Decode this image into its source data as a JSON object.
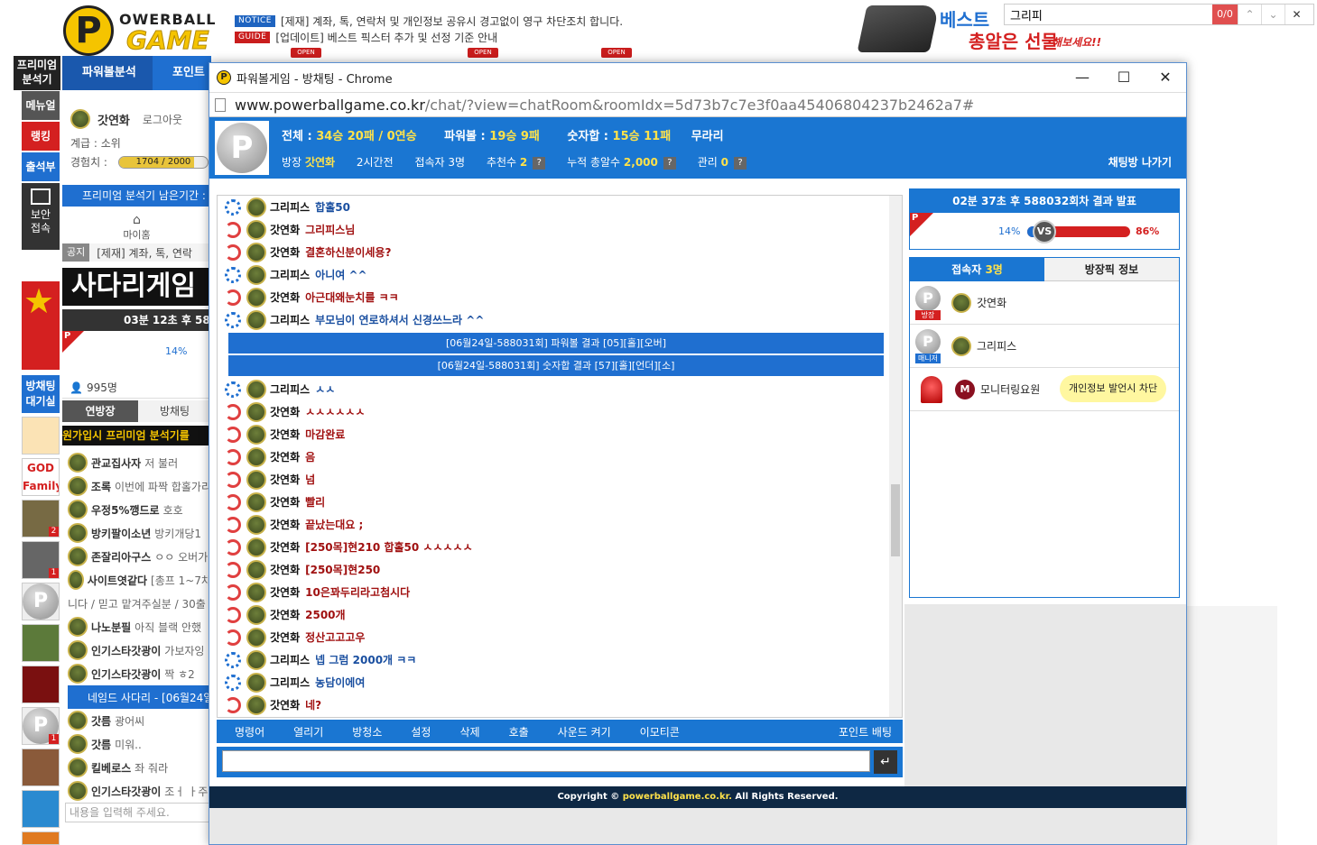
{
  "logo": {
    "letter": "P",
    "line1": "OWERBALL",
    "line2": "GAME"
  },
  "notices": [
    {
      "tag": "NOTICE",
      "text": "[제재] 계좌, 톡, 연락처 및 개인정보 공유시 경고없이 영구 차단조치 합니다."
    },
    {
      "tag": "GUIDE",
      "text": "[업데이트] 베스트 픽스터 추가 및 선정 기준 안내"
    }
  ],
  "open_tags": [
    "OPEN",
    "OPEN",
    "OPEN"
  ],
  "ad": {
    "line1": "베스트",
    "line2": "총알은 선물",
    "line3": "해보세요!!"
  },
  "find_bar": {
    "query": "그리피",
    "count": "0/0",
    "prev": "⌃",
    "next": "⌄",
    "close": "✕"
  },
  "left_nav": {
    "premium": "프리미엄\n분석기",
    "manual": "메뉴얼",
    "ranking": "랭킹",
    "attendance": "출석부",
    "secure": "보안\n접속",
    "chat_wait": "방채팅\n대기실"
  },
  "left_panel": {
    "tabs": [
      "파워볼분석",
      "포인트"
    ],
    "user_name": "갓연화",
    "logout": "로그아웃",
    "grade_label": "계급 : 소위",
    "exp_label": "경험치 :",
    "exp_value": "1704 / 2000",
    "exp_fraction": 0.852,
    "premium_remaining": "프리미엄 분석기 남은기간 :",
    "myhome": "마이홈",
    "notice_tag": "공지",
    "notice_text": "[제재] 계좌, 톡, 연락",
    "ladder_banner": "사다리게임",
    "timer": "03분 12초 후 588",
    "pct_left": "14%",
    "member_count": "995명",
    "tab_a": "연방장",
    "tab_b": "방채팅",
    "ticker": "원가입시 프리미엄 분석기를",
    "list": [
      {
        "name": "관교집사자",
        "msg": "저 불러"
      },
      {
        "name": "조록",
        "msg": "이번에 파짝 합홀가리"
      },
      {
        "name": "우정5%깽드로",
        "msg": "호호"
      },
      {
        "name": "방키팔이소년",
        "msg": "방키개당1"
      },
      {
        "name": "존잘리아구스",
        "msg": "ㅇㅇ 오버가"
      },
      {
        "name": "사이트엿같다",
        "msg": "[총프 1~7차"
      },
      {
        "name": "",
        "msg": "니다 / 믿고 맡겨주실분 / 30출"
      },
      {
        "name": "나노분필",
        "msg": "아직 블랙 안했"
      },
      {
        "name": "인기스타갓광이",
        "msg": "가보자잉"
      },
      {
        "name": "인기스타갓광이",
        "msg": "짝 ㅎ2"
      },
      {
        "name": "",
        "msg": "네임드 사다리 - [06월24일"
      },
      {
        "name": "갓름",
        "msg": "광어씨"
      },
      {
        "name": "갓름",
        "msg": "미워.."
      },
      {
        "name": "킬베로스",
        "msg": "좌 줘라"
      },
      {
        "name": "인기스타갓광이",
        "msg": "조ㅓ ㅏ주"
      }
    ],
    "input_placeholder": "내용을 입력해 주세요."
  },
  "window": {
    "title": "파워볼게임 - 방채팅 - Chrome",
    "controls": [
      "—",
      "☐",
      "✕"
    ],
    "url_host": "www.powerballgame.co.kr",
    "url_path": "/chat/?view=chatRoom&roomIdx=5d73b7c7e3f0aa45406804237b2462a7#"
  },
  "room": {
    "stats_total_label": "전체 :",
    "stats_total": "34승 20패",
    "stats_streak": "/ 0연승",
    "powerball_label": "파워볼 :",
    "powerball": "19승 9패",
    "sum_label": "숫자합 :",
    "sum": "15승 11패",
    "no_loss": "무라리",
    "owner_label": "방장",
    "owner": "갓연화",
    "elapsed": "2시간전",
    "users_label": "접속자",
    "users": "3명",
    "recommend_label": "추천수",
    "recommend": "2",
    "cumulative_label": "누적 총알수",
    "cumulative": "2,000",
    "manage_label": "관리",
    "manage": "0",
    "exit": "채팅방 나가기"
  },
  "chat": [
    {
      "lv": "blue",
      "name": "그리피스",
      "msg": "합홀50",
      "color": "blue"
    },
    {
      "lv": "red",
      "name": "갓연화",
      "msg": "그리피스님",
      "color": "red"
    },
    {
      "lv": "red",
      "name": "갓연화",
      "msg": "결혼하신분이세용?",
      "color": "red"
    },
    {
      "lv": "blue",
      "name": "그리피스",
      "msg": "아니여 ^^",
      "color": "blue"
    },
    {
      "lv": "red",
      "name": "갓연화",
      "msg": "아근대왜눈치를 ㅋㅋ",
      "color": "red"
    },
    {
      "lv": "blue",
      "name": "그리피스",
      "msg": "부모님이 연로하셔서  신경쓰느라 ^^",
      "color": "blue"
    },
    {
      "sys": "[06월24일-588031회] 파워볼 결과 [05][홀][오버]"
    },
    {
      "sys": "[06월24일-588031회] 숫자합 결과 [57][홀][언더][소]"
    },
    {
      "lv": "blue",
      "name": "그리피스",
      "msg": "ㅅㅅ",
      "color": "blue"
    },
    {
      "lv": "red",
      "name": "갓연화",
      "msg": "ㅅㅅㅅㅅㅅㅅ",
      "color": "red"
    },
    {
      "lv": "red",
      "name": "갓연화",
      "msg": "마감완료",
      "color": "red"
    },
    {
      "lv": "red",
      "name": "갓연화",
      "msg": "음",
      "color": "red"
    },
    {
      "lv": "red",
      "name": "갓연화",
      "msg": "넘",
      "color": "red"
    },
    {
      "lv": "red",
      "name": "갓연화",
      "msg": "빨리",
      "color": "red"
    },
    {
      "lv": "red",
      "name": "갓연화",
      "msg": "끝났는대요 ;",
      "color": "red"
    },
    {
      "lv": "red",
      "name": "갓연화",
      "msg": " [250목]현210 합홀50 ㅅㅅㅅㅅㅅ",
      "color": "red"
    },
    {
      "lv": "red",
      "name": "갓연화",
      "msg": " [250목]현250",
      "color": "red"
    },
    {
      "lv": "red",
      "name": "갓연화",
      "msg": "10은꽈두리라고첨시다",
      "color": "red"
    },
    {
      "lv": "red",
      "name": "갓연화",
      "msg": "2500개",
      "color": "red"
    },
    {
      "lv": "red",
      "name": "갓연화",
      "msg": "정산고고고우",
      "color": "red"
    },
    {
      "lv": "blue",
      "name": "그리피스",
      "msg": "넵 그럼 2000개 ㅋㅋ",
      "color": "blue"
    },
    {
      "lv": "blue",
      "name": "그리피스",
      "msg": "농담이에여",
      "color": "blue"
    },
    {
      "lv": "red",
      "name": "갓연화",
      "msg": "네?",
      "color": "red"
    }
  ],
  "toolbar": [
    "명령어",
    "열리기",
    "방청소",
    "설정",
    "삭제",
    "호출",
    "사운드 켜기",
    "이모티콘",
    "포인트 배팅"
  ],
  "footer": {
    "prefix": "Copyright ©",
    "site": "powerballgame.co.kr.",
    "suffix": "All Rights Reserved."
  },
  "result_panel": {
    "timer": "02분 37초 후",
    "round": "588032회차",
    "suffix": "결과 발표",
    "p_label": "P",
    "left_pct": "14%",
    "right_pct": "86%",
    "left_fraction": 0.14,
    "vs": "VS"
  },
  "users_panel": {
    "tab_users_label": "접속자",
    "tab_users_count": "3명",
    "tab_info": "방장픽 정보",
    "users": [
      {
        "name": "갓연화",
        "role": "방장",
        "role_color": "#d42020"
      },
      {
        "name": "그리피스",
        "role": "매니저",
        "role_color": "#1f6fd0"
      },
      {
        "name": "모니터링요원",
        "badge": "M"
      }
    ],
    "tooltip": "개인정보 발언시 차단"
  },
  "colors": {
    "brand_blue": "#1a76d2",
    "accent_red": "#d42020",
    "accent_yellow": "#ffe24a",
    "footer": "#0e2844"
  }
}
